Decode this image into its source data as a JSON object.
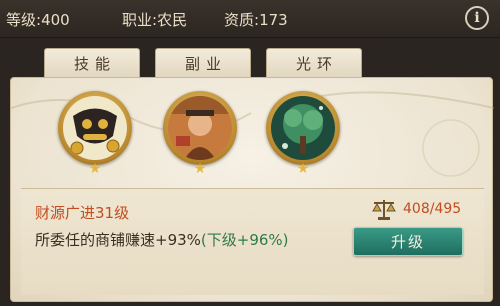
{
  "header": {
    "level_label": "等级:",
    "level_value": "400",
    "job_label": "职业:",
    "job_value": "农民",
    "quality_label": "资质:",
    "quality_value": "173",
    "info_icon": "info-icon"
  },
  "tabs": [
    {
      "label": "技能"
    },
    {
      "label": "副业"
    },
    {
      "label": "光环"
    }
  ],
  "skills": [
    {
      "icon": "coin-cat-skill-icon"
    },
    {
      "icon": "worker-skill-icon"
    },
    {
      "icon": "tree-skill-icon"
    }
  ],
  "detail": {
    "title": "财源广进31级",
    "desc_main": "所委任的商铺赚速+93%",
    "desc_next": "(下级+96%)",
    "cost": "408/495",
    "cost_icon": "scale-icon",
    "upgrade_label": "升级"
  }
}
